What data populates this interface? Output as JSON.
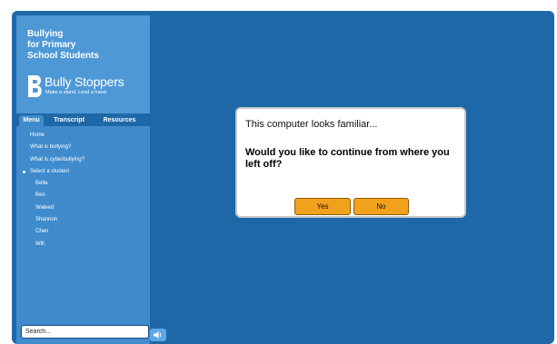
{
  "brand": {
    "title_lines": [
      "Bullying",
      "for Primary",
      "School Students"
    ],
    "logo_name": "Bully Stoppers",
    "logo_tagline": "Make a stand. Lend a hand."
  },
  "tabs": [
    {
      "label": "Menu",
      "active": true
    },
    {
      "label": "Transcript",
      "active": false
    },
    {
      "label": "Resources",
      "active": false
    }
  ],
  "menu": {
    "items": [
      {
        "label": "Home",
        "level": 0
      },
      {
        "label": "What is bullying?",
        "level": 0
      },
      {
        "label": "What is cyberbullying?",
        "level": 0
      },
      {
        "label": "Select a student",
        "level": 0,
        "bullet": true
      },
      {
        "label": "Bella",
        "level": 1
      },
      {
        "label": "Ben",
        "level": 1
      },
      {
        "label": "Waleed",
        "level": 1
      },
      {
        "label": "Shannon",
        "level": 1
      },
      {
        "label": "Chen",
        "level": 1
      },
      {
        "label": "Will",
        "level": 1
      }
    ]
  },
  "search": {
    "placeholder": "Search..."
  },
  "dialog": {
    "title": "This computer looks familiar...",
    "question": "Would you like to continue from where you left off?",
    "yes_label": "Yes",
    "no_label": "No"
  },
  "icons": {
    "logo": "bully-stoppers-b-logo-icon",
    "sound": "speaker-icon"
  },
  "colors": {
    "background": "#1f68a8",
    "sidebar": "#3f8bcc",
    "brand_panel": "#4e98d6",
    "button_accent": "#f2a11c"
  }
}
